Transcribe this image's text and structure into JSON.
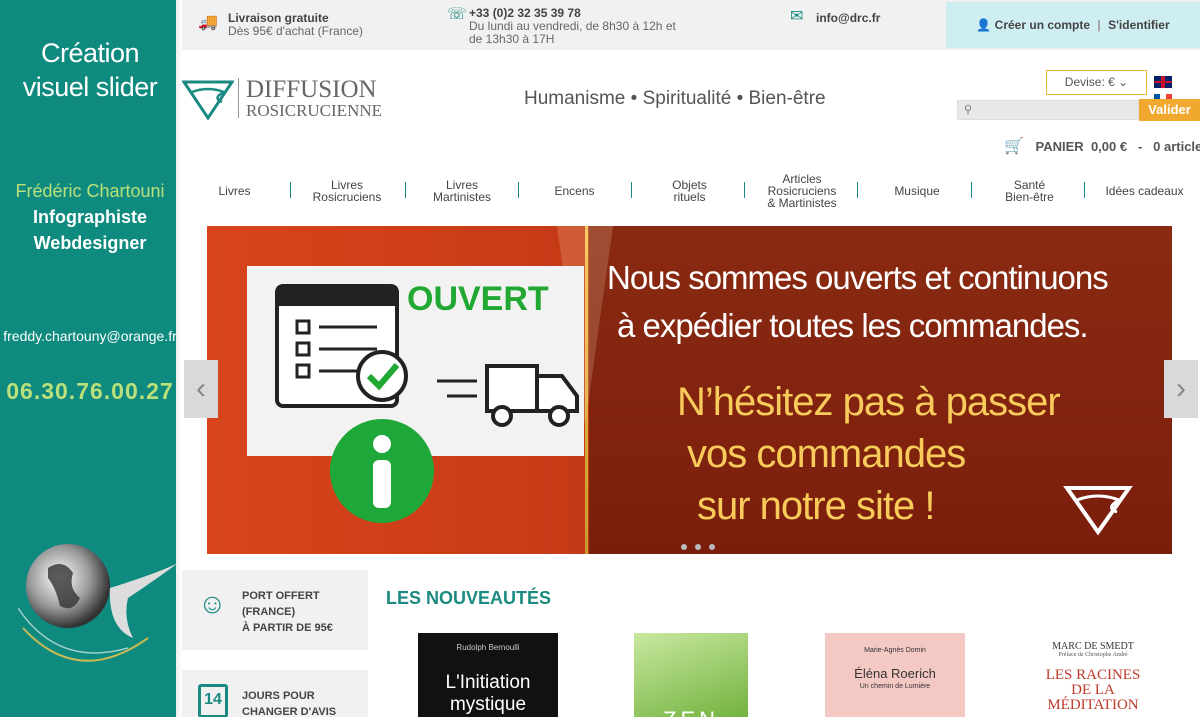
{
  "sidebar": {
    "title_line1": "Création",
    "title_line2": "visuel slider",
    "author": "Frédéric Chartouni",
    "role1": "Infographiste",
    "role2": "Webdesigner",
    "email": "freddy.chartouny@orange.fr",
    "phone": "06.30.76.00.27"
  },
  "topbar": {
    "shipping_title": "Livraison gratuite",
    "shipping_sub": "Dès 95€ d'achat (France)",
    "phone": "+33 (0)2 32 35 39 78",
    "hours_line1": "Du lundi au vendredi, de 8h30 à 12h et",
    "hours_line2": "de 13h30 à 17H",
    "email": "info@drc.fr",
    "create_account": "Créer un compte",
    "divider": "|",
    "login": "S'identifier"
  },
  "header": {
    "brand_line1": "DIFFUSION",
    "brand_line2": "ROSICRUCIENNE",
    "tagline": "Humanisme • Spiritualité • Bien-être",
    "currency": "Devise: €",
    "search_button": "Valider",
    "cart_label": "PANIER",
    "cart_amount": "0,00 €",
    "cart_dash": "-",
    "cart_count": "0 article"
  },
  "menu": {
    "items": [
      {
        "line1": "Livres",
        "line2": ""
      },
      {
        "line1": "Livres",
        "line2": "Rosicruciens"
      },
      {
        "line1": "Livres",
        "line2": "Martinistes"
      },
      {
        "line1": "Encens",
        "line2": ""
      },
      {
        "line1": "Objets",
        "line2": "rituels"
      },
      {
        "line1": "Articles",
        "line2": "Rosicruciens",
        "line3": "& Martinistes"
      },
      {
        "line1": "Musique",
        "line2": ""
      },
      {
        "line1": "Santé",
        "line2": "Bien-être"
      },
      {
        "line1": "Idées cadeaux",
        "line2": ""
      }
    ]
  },
  "slider": {
    "ouvert": "OUVERT",
    "text1_line1": "Nous sommes ouverts et continuons",
    "text1_line2": "à expédier toutes les commandes.",
    "text2_line1": "N’hésitez pas à passer",
    "text2_line2": "vos commandes",
    "text2_line3": "sur notre site !"
  },
  "features": [
    {
      "line1": "PORT OFFERT",
      "line2": "(FRANCE)",
      "line3": "À PARTIR DE 95€"
    },
    {
      "line1": "JOURS POUR",
      "line2": "CHANGER D'AVIS",
      "number": "14"
    }
  ],
  "new_arrivals": {
    "heading": "LES NOUVEAUTÉS",
    "books": [
      {
        "author": "Rudolph Bernoulli",
        "title_line1": "L'Initiation",
        "title_line2": "mystique"
      },
      {
        "author": "",
        "title_line1": "ZEN",
        "title_line2": ""
      },
      {
        "author": "Marie-Agnès Domin",
        "title_line1": "Éléna Roerich",
        "title_line2": "Un chemin de Lumière"
      },
      {
        "author": "MARC DE SMEDT",
        "preface": "Préface de Christophe André",
        "title_line1": "LES RACINES",
        "title_line2": "DE LA",
        "title_line3": "MÉDITATION"
      }
    ]
  },
  "colors": {
    "teal": "#0f8a7e",
    "accent_green": "#b9e07a",
    "orange": "#f0a92e",
    "slider_red": "#c43a16",
    "slider_gold": "#f9cb5a"
  }
}
